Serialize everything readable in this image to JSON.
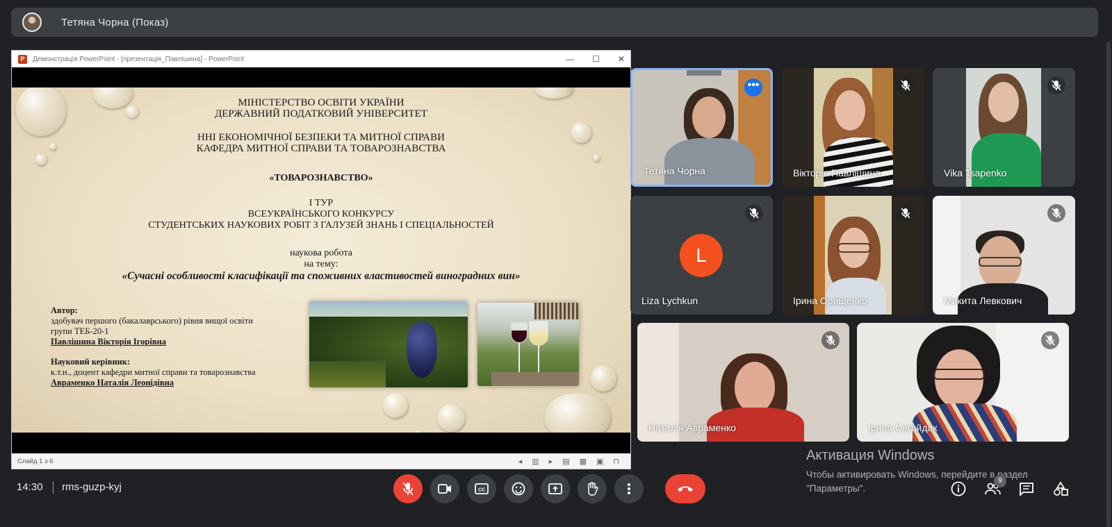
{
  "presenter_bar": {
    "label": "Тетяна Чорна (Показ)"
  },
  "ppt_window": {
    "title": "Демонстрація PowerPoint - [презентація_Павлішина] - PowerPoint",
    "status": "Слайд 1 з 6"
  },
  "slide": {
    "line1": "МІНІСТЕРСТВО ОСВІТИ УКРАЇНИ",
    "line2": "ДЕРЖАВНИЙ ПОДАТКОВИЙ УНІВЕРСИТЕТ",
    "line3": "ННІ ЕКОНОМІЧНОЇ БЕЗПЕКИ ТА МИТНОЇ СПРАВИ",
    "line4": "КАФЕДРА МИТНОЇ СПРАВИ ТА ТОВАРОЗНАВСТВА",
    "line5": "«ТОВАРОЗНАВСТВО»",
    "line6": "І ТУР",
    "line7": "ВСЕУКРАЇНСЬКОГО КОНКУРСУ",
    "line8": "СТУДЕНТСЬКИХ НАУКОВИХ РОБІТ З ГАЛУЗЕЙ ЗНАНЬ І СПЕЦІАЛЬНОСТЕЙ",
    "line9": "наукова робота",
    "line10": "на тему:",
    "topic": "«Сучасні особливості класифікації та споживних властивостей виноградних вин»",
    "author_label": "Автор:",
    "author_desc1": "здобувач першого (бакалаврського) рівня вищої освіти",
    "author_desc2": "групи ТЕБ-20-1",
    "author_name": "Павлішина Вікторія Ігорівна",
    "supervisor_label": "Науковий керівник:",
    "supervisor_desc": "к.т.н., доцент кафедри митної справи та товарознавства",
    "supervisor_name": "Авраменко Наталія Леонідівна"
  },
  "participants": [
    {
      "name": "Тетяна Чорна"
    },
    {
      "name": "Вікторія Павлішина"
    },
    {
      "name": "Vika Tsapenko"
    },
    {
      "name": "Liza Lychkun",
      "initial": "L"
    },
    {
      "name": "Ірина Орищенко"
    },
    {
      "name": "Микита Левкович"
    },
    {
      "name": "Наталія Авраменко"
    },
    {
      "name": "Ірина Сагайдак"
    }
  ],
  "bottom_bar": {
    "time": "14:30",
    "meeting_code": "rms-guzp-kyj",
    "people_count": "9"
  },
  "windows_activation": {
    "title": "Активация Windows",
    "line1": "Чтобы активировать Windows, перейдите в раздел",
    "line2": "\"Параметры\"."
  },
  "colors": {
    "background": "#202124",
    "tile": "#3c4043",
    "red": "#ea4335",
    "active_border": "#8ab4f8",
    "avatar_orange": "#f4511e"
  }
}
